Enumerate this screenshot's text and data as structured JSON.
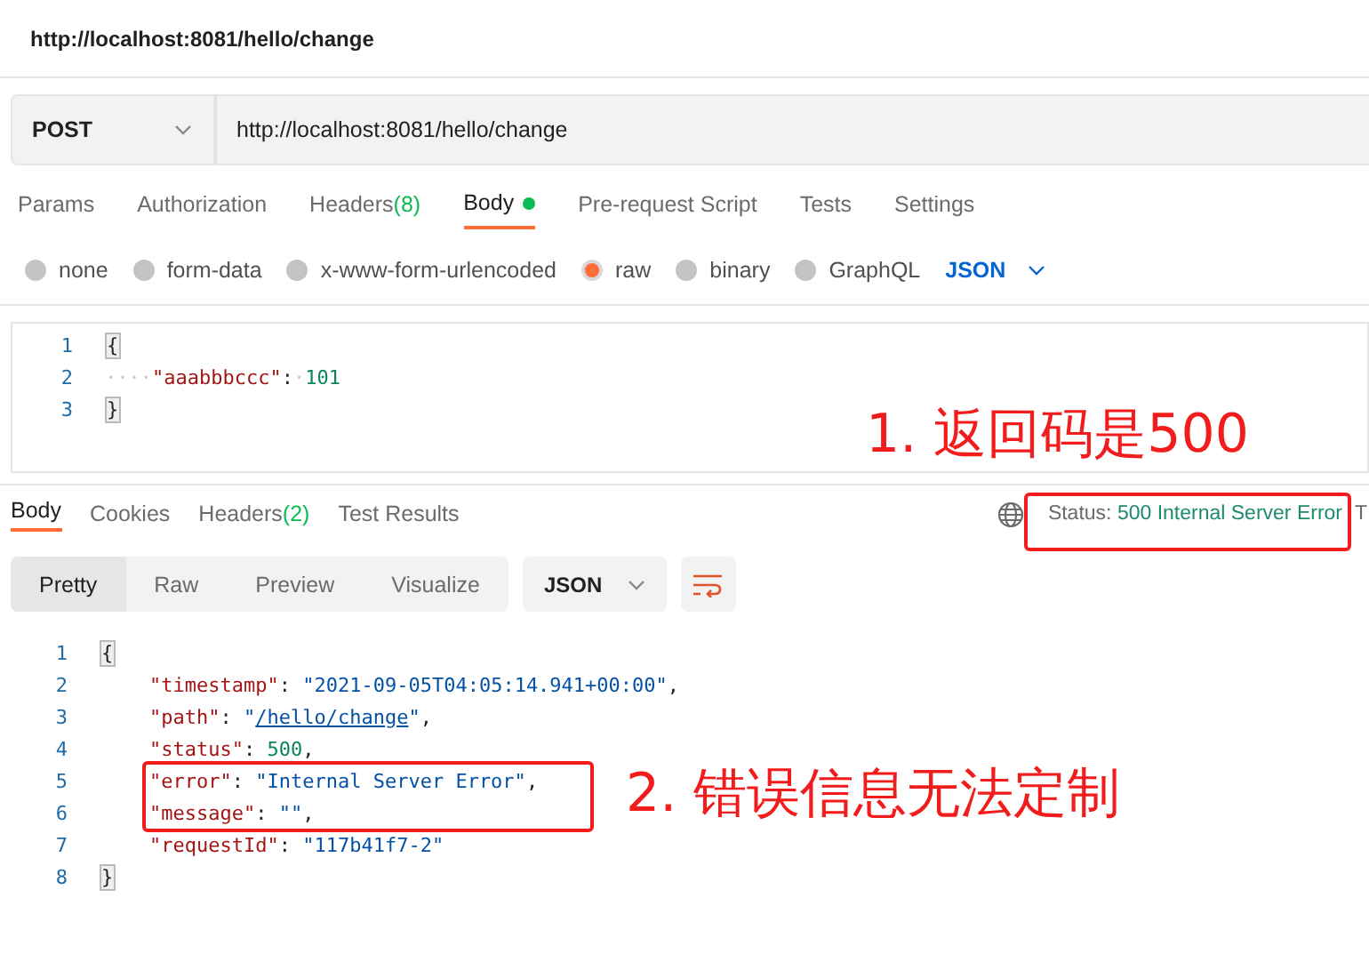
{
  "window": {
    "title": "http://localhost:8081/hello/change"
  },
  "request": {
    "method": "POST",
    "url": "http://localhost:8081/hello/change"
  },
  "request_tabs": [
    {
      "label": "Params",
      "selected": false
    },
    {
      "label": "Authorization",
      "selected": false
    },
    {
      "label": "Headers",
      "count": "(8)",
      "selected": false
    },
    {
      "label": "Body",
      "dot": true,
      "selected": true
    },
    {
      "label": "Pre-request Script",
      "selected": false
    },
    {
      "label": "Tests",
      "selected": false
    },
    {
      "label": "Settings",
      "selected": false
    }
  ],
  "body_types": [
    {
      "label": "none",
      "selected": false
    },
    {
      "label": "form-data",
      "selected": false
    },
    {
      "label": "x-www-form-urlencoded",
      "selected": false
    },
    {
      "label": "raw",
      "selected": true
    },
    {
      "label": "binary",
      "selected": false
    },
    {
      "label": "GraphQL",
      "selected": false
    }
  ],
  "body_format": "JSON",
  "request_body": [
    {
      "num": "1",
      "tokens": [
        {
          "kind": "bracket",
          "text": "{"
        }
      ]
    },
    {
      "num": "2",
      "tokens": [
        {
          "kind": "ws",
          "text": "····"
        },
        {
          "kind": "key",
          "text": "\"aaabbbccc\""
        },
        {
          "kind": "punct",
          "text": ":"
        },
        {
          "kind": "ws",
          "text": "·"
        },
        {
          "kind": "number",
          "text": "101"
        }
      ]
    },
    {
      "num": "3",
      "tokens": [
        {
          "kind": "bracket",
          "text": "}"
        }
      ]
    }
  ],
  "response_tabs": [
    {
      "label": "Body",
      "selected": true
    },
    {
      "label": "Cookies",
      "selected": false
    },
    {
      "label": "Headers",
      "count": "(2)",
      "selected": false
    },
    {
      "label": "Test Results",
      "selected": false
    }
  ],
  "status": {
    "label": "Status:",
    "value": "500 Internal Server Error",
    "cut": "T"
  },
  "view_modes": [
    {
      "label": "Pretty",
      "selected": true
    },
    {
      "label": "Raw",
      "selected": false
    },
    {
      "label": "Preview",
      "selected": false
    },
    {
      "label": "Visualize",
      "selected": false
    }
  ],
  "response_format": "JSON",
  "response_body": [
    {
      "num": "1",
      "tokens": [
        {
          "kind": "bracket",
          "text": "{"
        }
      ]
    },
    {
      "num": "2",
      "tokens": [
        {
          "kind": "key",
          "text": "\"timestamp\""
        },
        {
          "kind": "punct",
          "text": ": "
        },
        {
          "kind": "string",
          "text": "\"2021-09-05T04:05:14.941+00:00\""
        },
        {
          "kind": "punct",
          "text": ","
        }
      ]
    },
    {
      "num": "3",
      "tokens": [
        {
          "kind": "key",
          "text": "\"path\""
        },
        {
          "kind": "punct",
          "text": ": "
        },
        {
          "kind": "string",
          "text": "\""
        },
        {
          "kind": "link",
          "text": "/hello/change"
        },
        {
          "kind": "string",
          "text": "\""
        },
        {
          "kind": "punct",
          "text": ","
        }
      ]
    },
    {
      "num": "4",
      "tokens": [
        {
          "kind": "key",
          "text": "\"status\""
        },
        {
          "kind": "punct",
          "text": ": "
        },
        {
          "kind": "number",
          "text": "500"
        },
        {
          "kind": "punct",
          "text": ","
        }
      ]
    },
    {
      "num": "5",
      "tokens": [
        {
          "kind": "key",
          "text": "\"error\""
        },
        {
          "kind": "punct",
          "text": ": "
        },
        {
          "kind": "string",
          "text": "\"Internal Server Error\""
        },
        {
          "kind": "punct",
          "text": ","
        }
      ]
    },
    {
      "num": "6",
      "tokens": [
        {
          "kind": "key",
          "text": "\"message\""
        },
        {
          "kind": "punct",
          "text": ": "
        },
        {
          "kind": "string",
          "text": "\"\""
        },
        {
          "kind": "punct",
          "text": ","
        }
      ]
    },
    {
      "num": "7",
      "tokens": [
        {
          "kind": "key",
          "text": "\"requestId\""
        },
        {
          "kind": "punct",
          "text": ": "
        },
        {
          "kind": "string",
          "text": "\"117b41f7-2\""
        }
      ]
    },
    {
      "num": "8",
      "tokens": [
        {
          "kind": "bracket",
          "text": "}"
        }
      ]
    }
  ],
  "annotations": [
    {
      "kind": "status",
      "text": "1. 返回码是500"
    },
    {
      "kind": "message",
      "text": "2. 错误信息无法定制"
    }
  ]
}
